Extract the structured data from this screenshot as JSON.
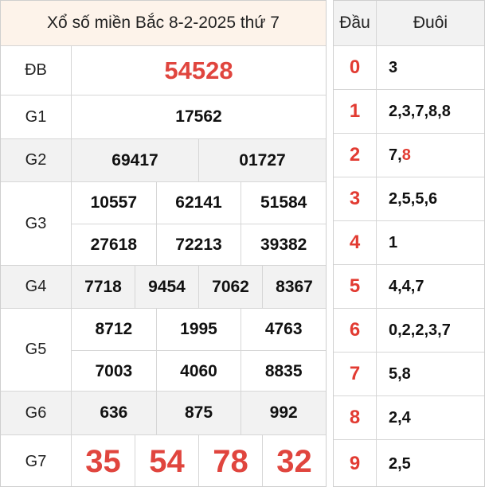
{
  "header": {
    "title": "Xổ số miền Bắc 8-2-2025 thứ 7"
  },
  "results": {
    "db": {
      "label": "ĐB",
      "numbers": [
        "54528"
      ]
    },
    "g1": {
      "label": "G1",
      "numbers": [
        "17562"
      ]
    },
    "g2": {
      "label": "G2",
      "numbers": [
        "69417",
        "01727"
      ]
    },
    "g3": {
      "label": "G3",
      "numbers": [
        "10557",
        "62141",
        "51584",
        "27618",
        "72213",
        "39382"
      ]
    },
    "g4": {
      "label": "G4",
      "numbers": [
        "7718",
        "9454",
        "7062",
        "8367"
      ]
    },
    "g5": {
      "label": "G5",
      "numbers": [
        "8712",
        "1995",
        "4763",
        "7003",
        "4060",
        "8835"
      ]
    },
    "g6": {
      "label": "G6",
      "numbers": [
        "636",
        "875",
        "992"
      ]
    },
    "g7": {
      "label": "G7",
      "numbers": [
        "35",
        "54",
        "78",
        "32"
      ]
    }
  },
  "loto": {
    "header_dau": "Đầu",
    "header_duoi": "Đuôi",
    "rows": [
      {
        "dau": "0",
        "duoi": "3"
      },
      {
        "dau": "1",
        "duoi": "2,3,7,8,8"
      },
      {
        "dau": "2",
        "duoi_main": "7,",
        "duoi_highlight": "8"
      },
      {
        "dau": "3",
        "duoi": "2,5,5,6"
      },
      {
        "dau": "4",
        "duoi": "1"
      },
      {
        "dau": "5",
        "duoi": "4,4,7"
      },
      {
        "dau": "6",
        "duoi": "0,2,2,3,7"
      },
      {
        "dau": "7",
        "duoi": "5,8"
      },
      {
        "dau": "8",
        "duoi": "2,4"
      },
      {
        "dau": "9",
        "duoi": "2,5"
      }
    ]
  },
  "colors": {
    "special": "#e0453e",
    "header_bg": "#fdf3ea",
    "shade_bg": "#f2f2f2"
  }
}
